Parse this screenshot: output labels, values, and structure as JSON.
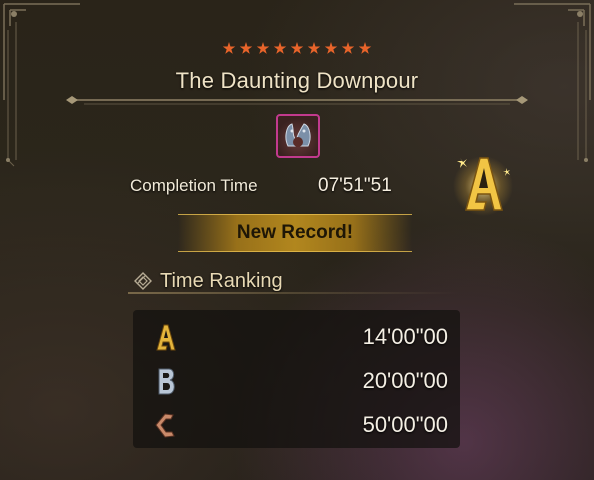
{
  "quest": {
    "stars": 9,
    "title": "The Daunting Downpour",
    "monster_icon": "monster-icon"
  },
  "completion": {
    "label": "Completion Time",
    "time": "07'51\"51",
    "rank": "A",
    "rank_icon": "rank-a-badge-icon"
  },
  "record": {
    "label": "New Record!"
  },
  "time_ranking": {
    "heading": "Time Ranking",
    "icon": "ranking-icon",
    "rows": [
      {
        "rank": "A",
        "time": "14'00\"00",
        "color": "#e3b43c"
      },
      {
        "rank": "B",
        "time": "20'00\"00",
        "color": "#b9c6d6"
      },
      {
        "rank": "C",
        "time": "50'00\"00",
        "color": "#c98a6a"
      }
    ]
  },
  "colors": {
    "star": "#e8642a",
    "gold": "#e3b43c",
    "record_bar": "#b98c1e",
    "text": "#f1ead8"
  }
}
